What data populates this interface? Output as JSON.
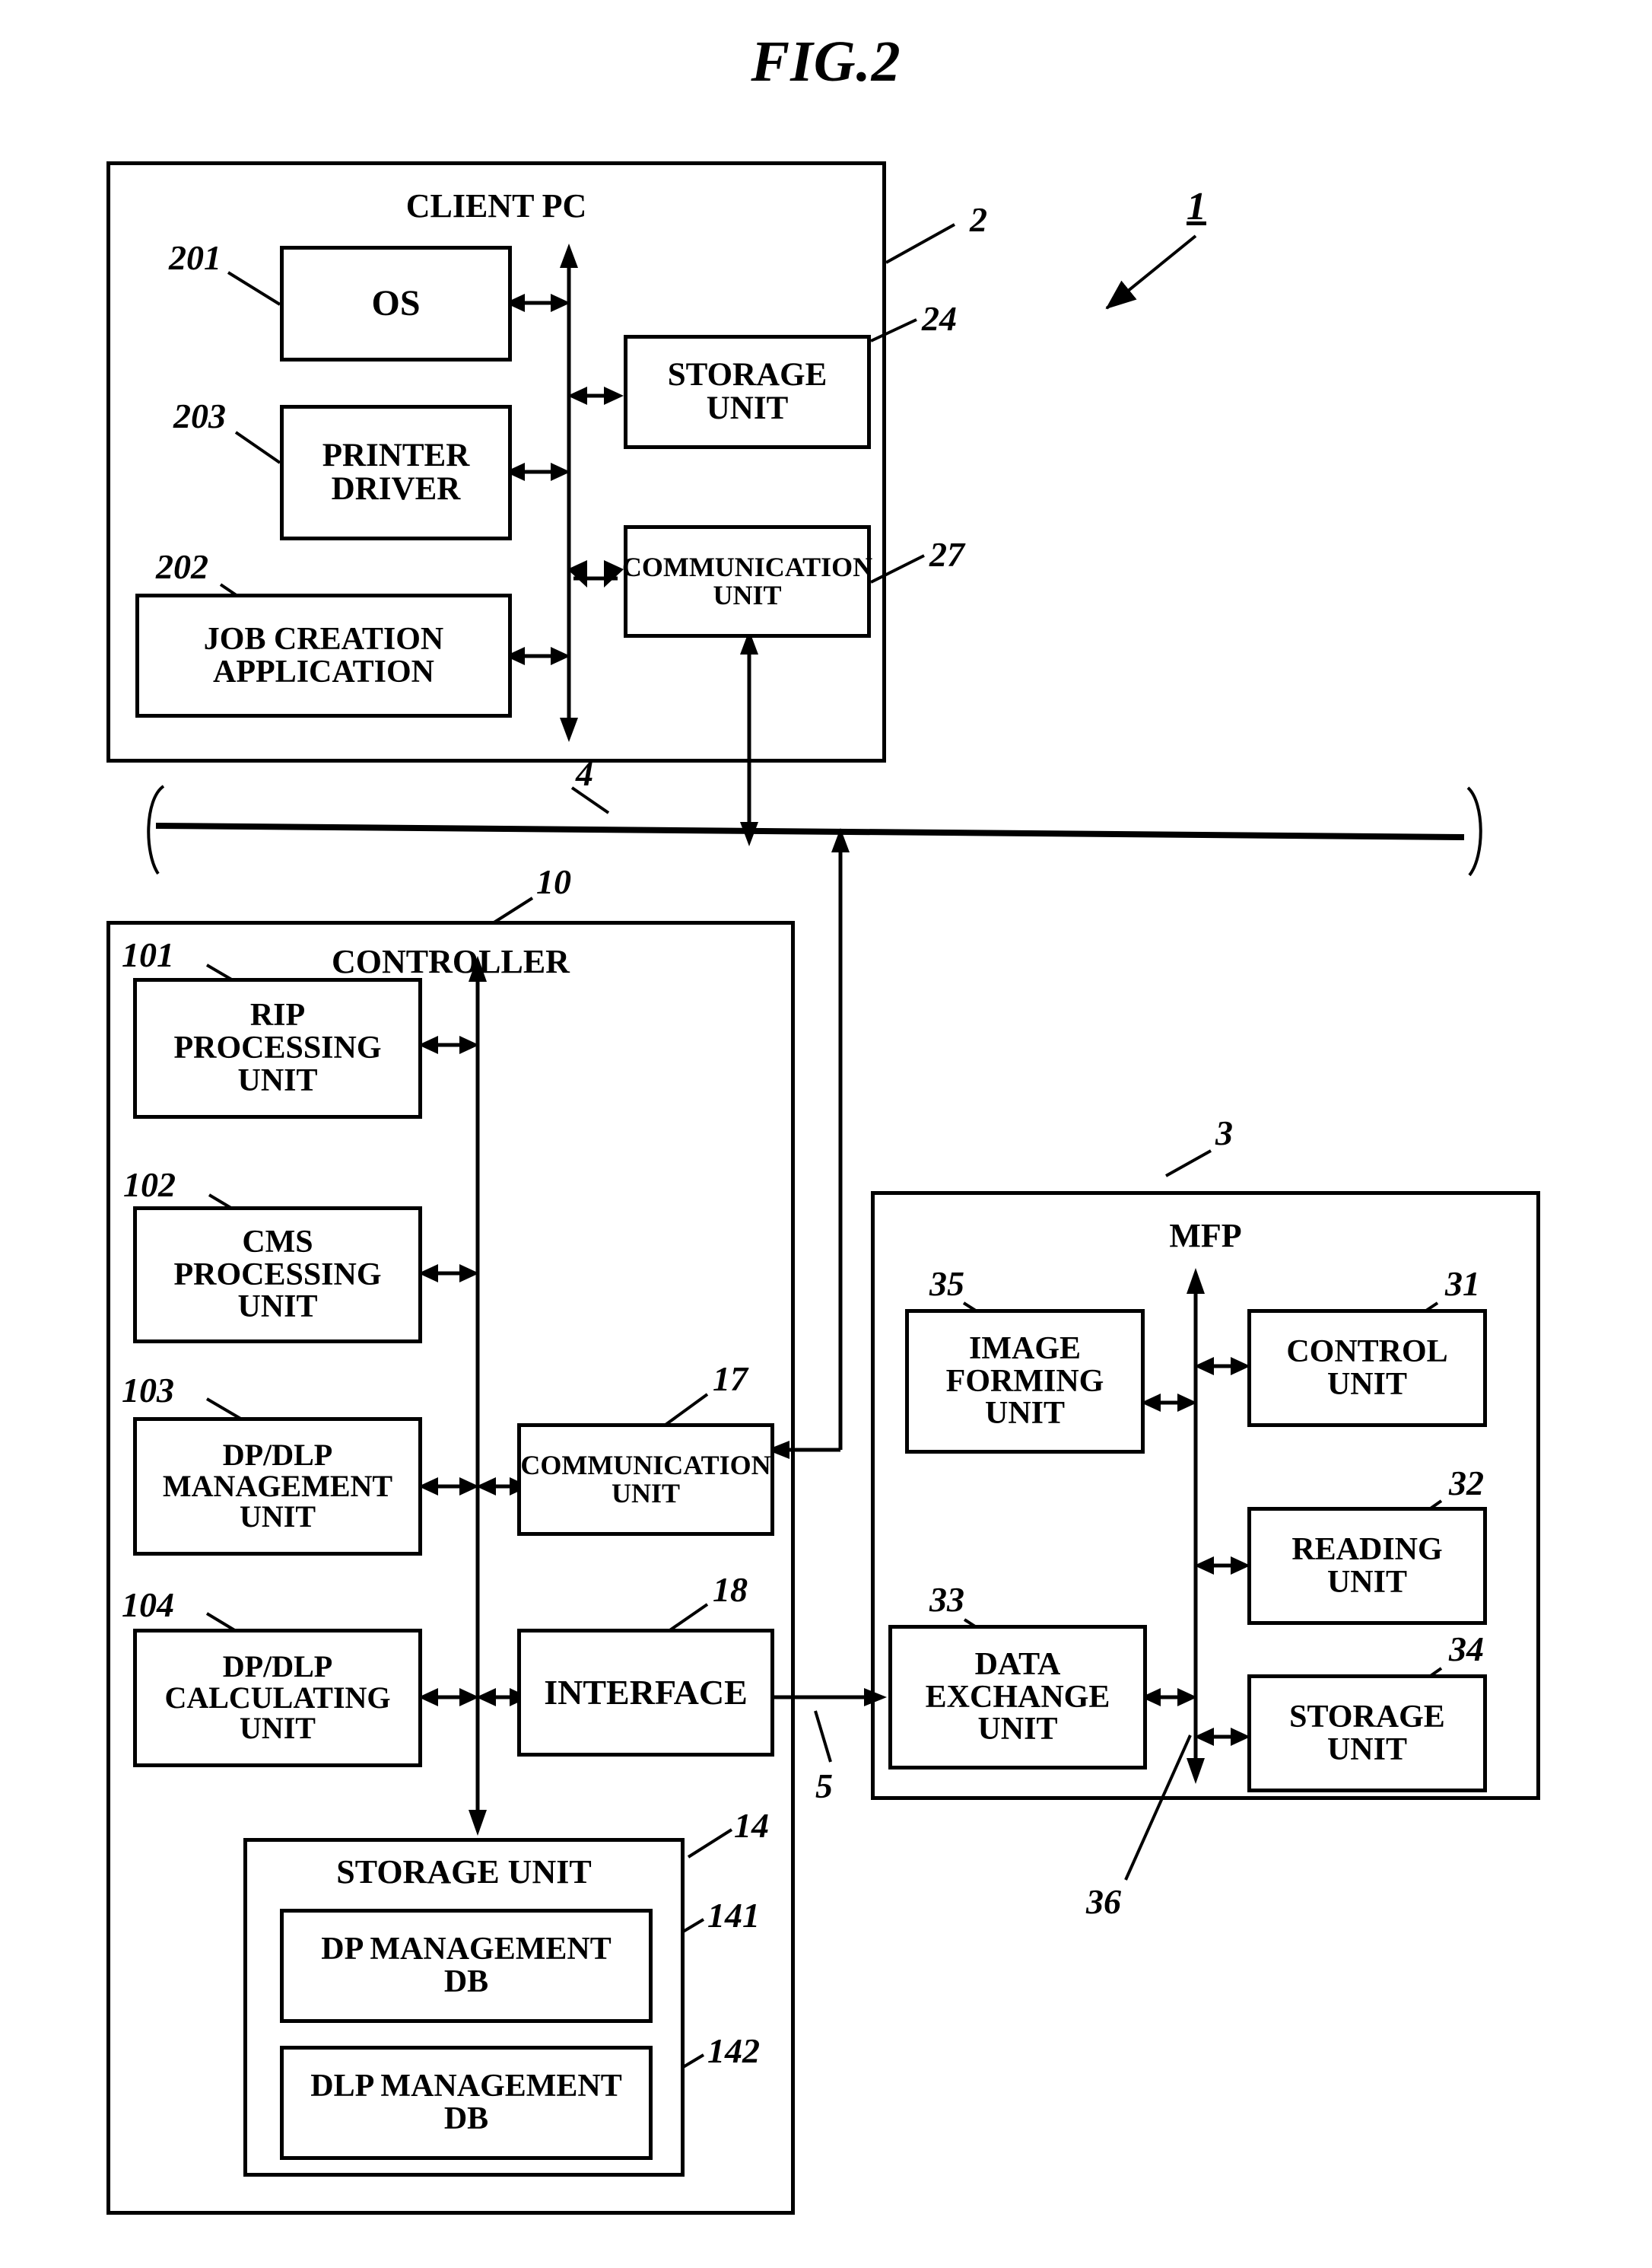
{
  "figure": {
    "title": "FIG.2",
    "system_ref": "1"
  },
  "client_pc": {
    "caption": "CLIENT PC",
    "ref": "2",
    "boxes": [
      {
        "label": "OS",
        "ref": "201"
      },
      {
        "label": "PRINTER\nDRIVER",
        "ref": "203"
      },
      {
        "label": "JOB CREATION\nAPPLICATION",
        "ref": "202"
      },
      {
        "label": "STORAGE\nUNIT",
        "ref": "24"
      },
      {
        "label": "COMMUNICATION\nUNIT",
        "ref": "27"
      }
    ]
  },
  "network": {
    "ref": "4"
  },
  "controller": {
    "caption": "CONTROLLER",
    "ref": "10",
    "boxes": [
      {
        "label": "RIP\nPROCESSING\nUNIT",
        "ref": "101"
      },
      {
        "label": "CMS\nPROCESSING\nUNIT",
        "ref": "102"
      },
      {
        "label": "DP/DLP\nMANAGEMENT\nUNIT",
        "ref": "103"
      },
      {
        "label": "DP/DLP\nCALCULATING\nUNIT",
        "ref": "104"
      },
      {
        "label": "COMMUNICATION\nUNIT",
        "ref": "17"
      },
      {
        "label": "INTERFACE",
        "ref": "18"
      }
    ],
    "storage": {
      "label": "STORAGE UNIT",
      "ref": "14",
      "databases": [
        {
          "label": "DP MANAGEMENT\nDB",
          "ref": "141"
        },
        {
          "label": "DLP MANAGEMENT\nDB",
          "ref": "142"
        }
      ]
    },
    "link_ref": "5"
  },
  "mfp": {
    "caption": "MFP",
    "ref": "3",
    "bus_ref": "36",
    "boxes": [
      {
        "label": "IMAGE\nFORMING\nUNIT",
        "ref": "35"
      },
      {
        "label": "CONTROL\nUNIT",
        "ref": "31"
      },
      {
        "label": "READING\nUNIT",
        "ref": "32"
      },
      {
        "label": "DATA\nEXCHANGE\nUNIT",
        "ref": "33"
      },
      {
        "label": "STORAGE\nUNIT",
        "ref": "34"
      }
    ]
  }
}
